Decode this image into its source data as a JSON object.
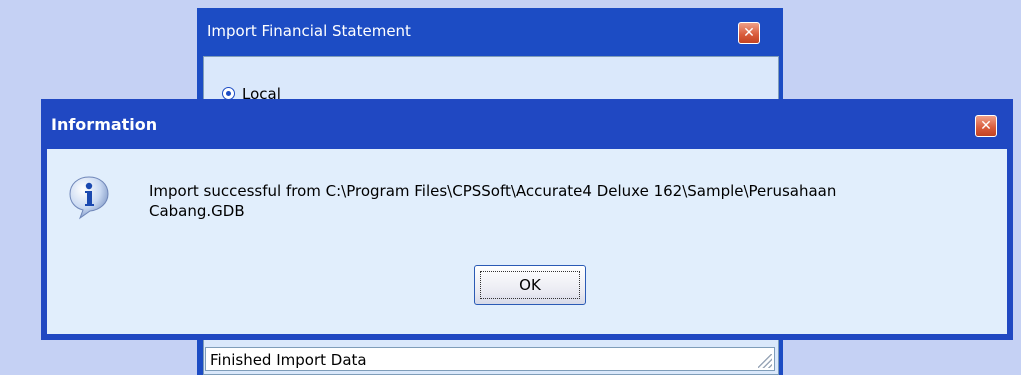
{
  "background_window": {
    "title": "Import Financial Statement",
    "radio_local_label": "Local",
    "status_text": "Finished Import Data"
  },
  "dialog": {
    "title": "Information",
    "message_line1": "Import successful from C:\\Program Files\\CPSSoft\\Accurate4 Deluxe 162\\Sample\\Perusahaan",
    "message_line2": "Cabang.GDB",
    "ok_label": "OK"
  },
  "icons": {
    "close": "close-icon",
    "info": "info-icon",
    "resize": "resize-grip-icon"
  },
  "colors": {
    "titlebar": "#1c4cc4",
    "dialog_bg": "#e1eefc",
    "close_button": "#d85a3a"
  }
}
